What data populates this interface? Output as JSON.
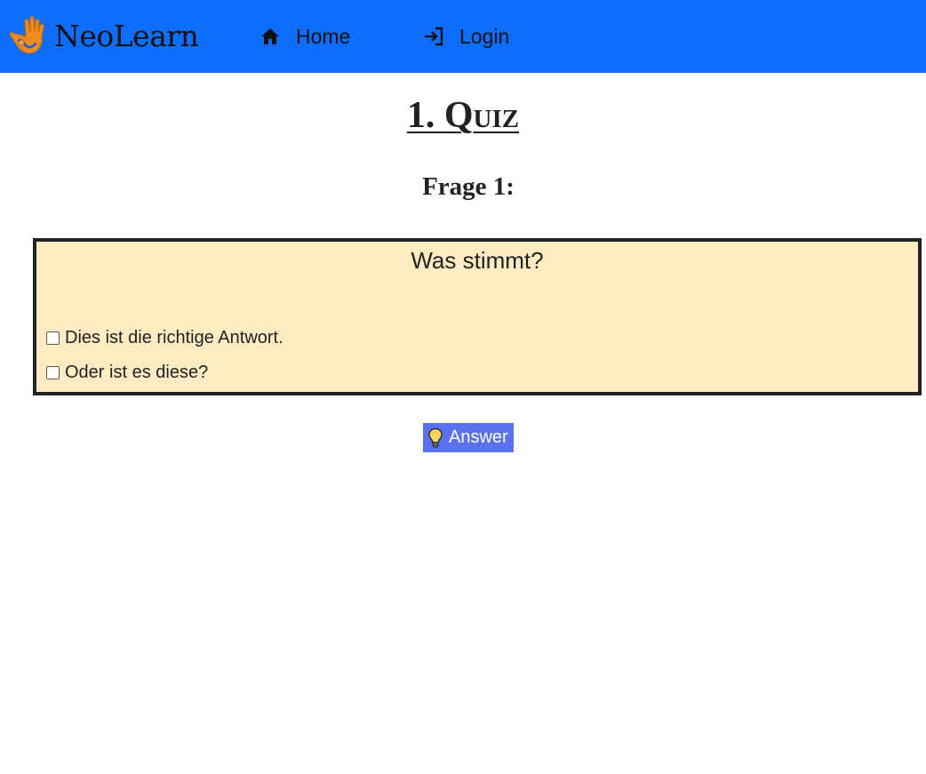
{
  "navbar": {
    "brand": "NeoLearn",
    "items": [
      {
        "label": "Home",
        "icon": "home-icon"
      },
      {
        "label": "Login",
        "icon": "login-icon"
      }
    ],
    "background_color": "#0d6efd"
  },
  "page": {
    "title": "1. Quiz",
    "question_number": "Frage 1:"
  },
  "quiz": {
    "question": "Was stimmt?",
    "options": [
      {
        "label": "Dies ist die richtige Antwort.",
        "checked": false
      },
      {
        "label": "Oder ist es diese?",
        "checked": false
      }
    ],
    "box_color": "#ffecc2"
  },
  "answer_button": {
    "label": "Answer",
    "icon": "lightbulb-icon",
    "color": "#5a72f0"
  }
}
